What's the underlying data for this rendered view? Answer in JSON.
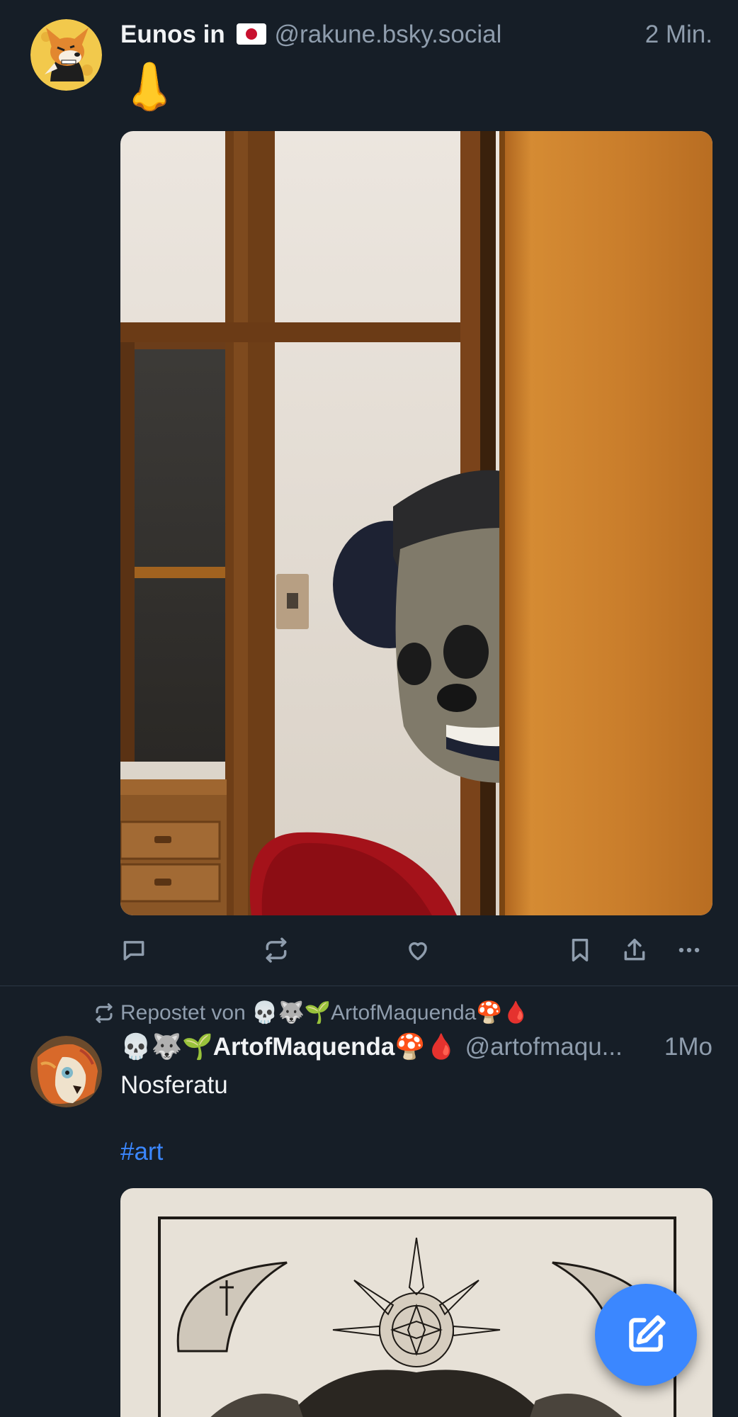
{
  "posts": [
    {
      "display_name": "Eunos in",
      "display_name_flag": "japan-flag",
      "handle": "@rakune.bsky.social",
      "time": "2 Min.",
      "text": "👃",
      "image_description_icon": "photo-plush-peeking-behind-door"
    },
    {
      "repost_label": "Repostet von 💀🐺🌱ArtofMaquenda🍄🩸",
      "display_name": "💀🐺🌱ArtofMaquenda🍄🩸",
      "handle": "@artofmaqu...",
      "time": "1Mo",
      "text": "Nosferatu",
      "hashtag": "#art",
      "image_description_icon": "artwork-nosferatu-etching"
    }
  ],
  "actions": [
    "reply",
    "repost",
    "like",
    "bookmark",
    "share",
    "more"
  ],
  "colors": {
    "background": "#161e27",
    "accent": "#3b87ff",
    "muted": "#8f9dad",
    "divider": "#2b3745"
  }
}
